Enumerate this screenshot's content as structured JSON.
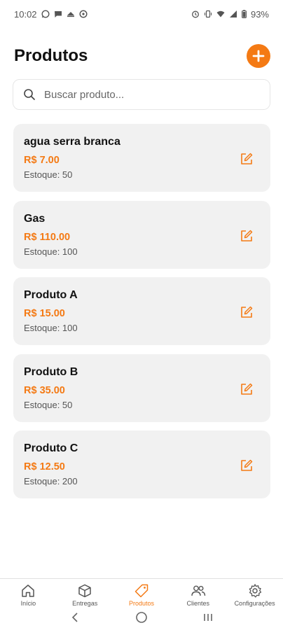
{
  "status": {
    "time": "10:02",
    "battery": "93%"
  },
  "page": {
    "title": "Produtos"
  },
  "search": {
    "placeholder": "Buscar produto..."
  },
  "products": [
    {
      "name": "agua serra branca",
      "price": "R$ 7.00",
      "stock": "Estoque: 50"
    },
    {
      "name": "Gas",
      "price": "R$ 110.00",
      "stock": "Estoque: 100"
    },
    {
      "name": "Produto A",
      "price": "R$ 15.00",
      "stock": "Estoque: 100"
    },
    {
      "name": "Produto B",
      "price": "R$ 35.00",
      "stock": "Estoque: 50"
    },
    {
      "name": "Produto C",
      "price": "R$ 12.50",
      "stock": "Estoque: 200"
    }
  ],
  "nav": {
    "items": [
      {
        "label": "Início",
        "icon": "home-icon"
      },
      {
        "label": "Entregas",
        "icon": "box-icon"
      },
      {
        "label": "Produtos",
        "icon": "tag-icon",
        "active": true
      },
      {
        "label": "Clientes",
        "icon": "users-icon"
      },
      {
        "label": "Configurações",
        "icon": "gear-icon"
      }
    ]
  },
  "colors": {
    "accent": "#f47a14",
    "card_bg": "#f1f1f1"
  }
}
